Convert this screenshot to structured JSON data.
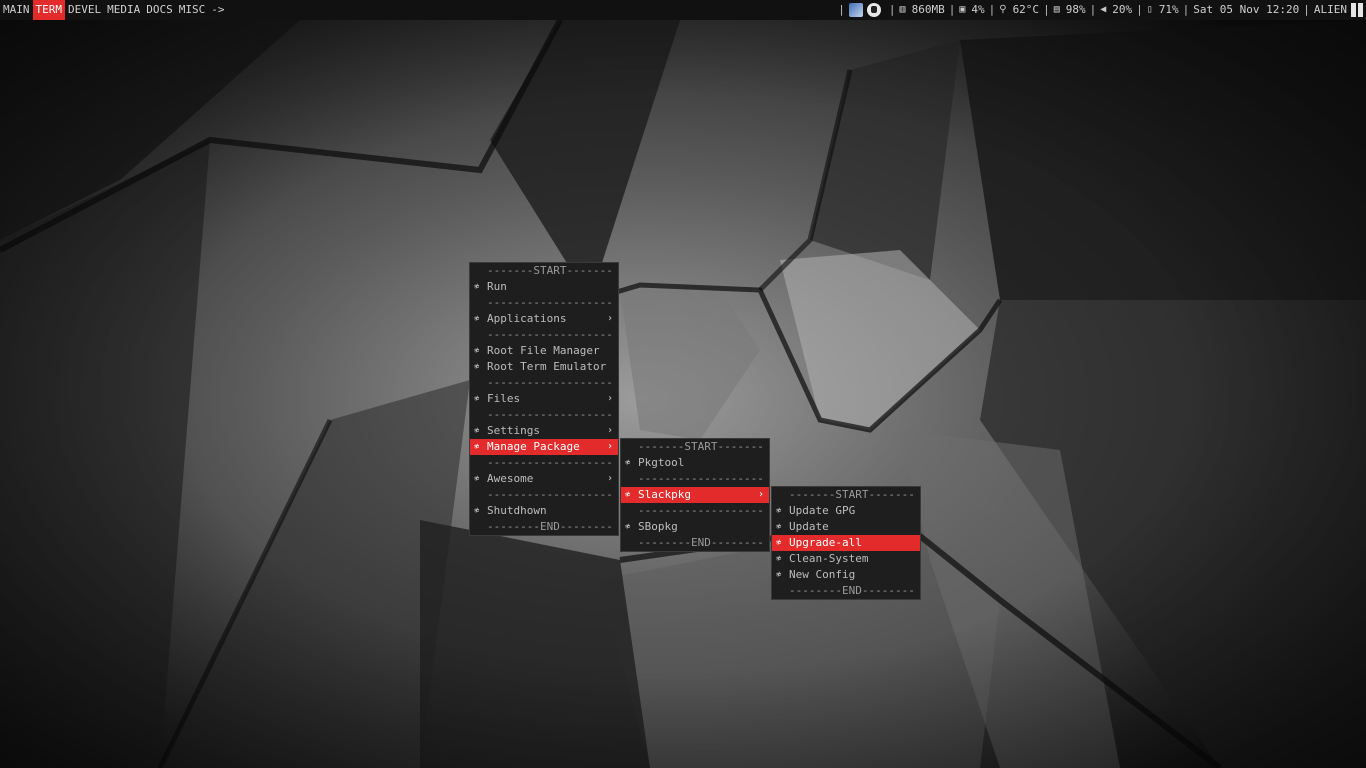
{
  "theme": {
    "accent": "#e32b2b",
    "bar_bg": "#111111",
    "menu_bg": "#1e1e1e",
    "menu_text": "#bdbdbd"
  },
  "tags": [
    {
      "label": "MAIN",
      "active": false
    },
    {
      "label": "TERM",
      "active": true
    },
    {
      "label": "DEVEL",
      "active": false
    },
    {
      "label": "MEDIA",
      "active": false
    },
    {
      "label": "DOCS",
      "active": false
    },
    {
      "label": "MISC",
      "active": false
    }
  ],
  "tag_arrow": "->",
  "status": {
    "separator": "|",
    "memory": "860MB",
    "cpu": "4%",
    "temperature": "62°C",
    "disk": "98%",
    "volume": "20%",
    "battery": "71%",
    "datetime": "Sat 05 Nov 12:20",
    "user": "ALIEN",
    "icons": [
      "network-tray-icon",
      "update-tray-icon",
      "memory-icon",
      "cpu-icon",
      "temperature-icon",
      "disk-icon",
      "volume-icon",
      "battery-icon",
      "layout-icon"
    ]
  },
  "menu_glyph": "≉",
  "menu_chevron": "›",
  "main_menu": [
    {
      "label": "-------START-------",
      "type": "separator"
    },
    {
      "label": "Run",
      "type": "item"
    },
    {
      "label": "-------------------",
      "type": "separator"
    },
    {
      "label": "Applications",
      "type": "submenu"
    },
    {
      "label": "-------------------",
      "type": "separator"
    },
    {
      "label": "Root File Manager",
      "type": "item"
    },
    {
      "label": "Root Term Emulator",
      "type": "item"
    },
    {
      "label": "-------------------",
      "type": "separator"
    },
    {
      "label": "Files",
      "type": "submenu"
    },
    {
      "label": "-------------------",
      "type": "separator"
    },
    {
      "label": "Settings",
      "type": "submenu"
    },
    {
      "label": "Manage Package",
      "type": "submenu",
      "selected": true
    },
    {
      "label": "-------------------",
      "type": "separator"
    },
    {
      "label": "Awesome",
      "type": "submenu"
    },
    {
      "label": "-------------------",
      "type": "separator"
    },
    {
      "label": "Shutdhown",
      "type": "item"
    },
    {
      "label": "--------END--------",
      "type": "separator"
    }
  ],
  "package_menu": [
    {
      "label": "-------START-------",
      "type": "separator"
    },
    {
      "label": "Pkgtool",
      "type": "item"
    },
    {
      "label": "-------------------",
      "type": "separator"
    },
    {
      "label": "Slackpkg",
      "type": "submenu",
      "selected": true
    },
    {
      "label": "-------------------",
      "type": "separator"
    },
    {
      "label": "SBopkg",
      "type": "item"
    },
    {
      "label": "--------END--------",
      "type": "separator"
    }
  ],
  "slackpkg_menu": [
    {
      "label": "-------START-------",
      "type": "separator"
    },
    {
      "label": "Update GPG",
      "type": "item"
    },
    {
      "label": "Update",
      "type": "item"
    },
    {
      "label": "Upgrade-all",
      "type": "item",
      "selected": true
    },
    {
      "label": "Clean-System",
      "type": "item"
    },
    {
      "label": "New Config",
      "type": "item"
    },
    {
      "label": "--------END--------",
      "type": "separator"
    }
  ]
}
